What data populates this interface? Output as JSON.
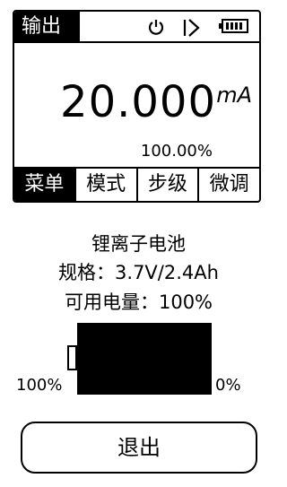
{
  "screen": {
    "mode_label": "输出",
    "icons": [
      "power-icon",
      "diode-icon",
      "battery-icon"
    ],
    "reading": {
      "value": "20.000",
      "unit": "mA",
      "percent": "100.00%"
    },
    "softkeys": [
      {
        "label": "菜单",
        "active": true
      },
      {
        "label": "模式",
        "active": false
      },
      {
        "label": "步级",
        "active": false
      },
      {
        "label": "微调",
        "active": false
      }
    ]
  },
  "battery_info": {
    "type": "锂离子电池",
    "spec": "规格：3.7V/2.4Ah",
    "capacity": "可用电量：100%",
    "level": 1.0,
    "left_label": "100%",
    "right_label": "0%"
  },
  "exit_label": "退出",
  "colors": {
    "foreground": "#000000",
    "background": "#ffffff"
  }
}
